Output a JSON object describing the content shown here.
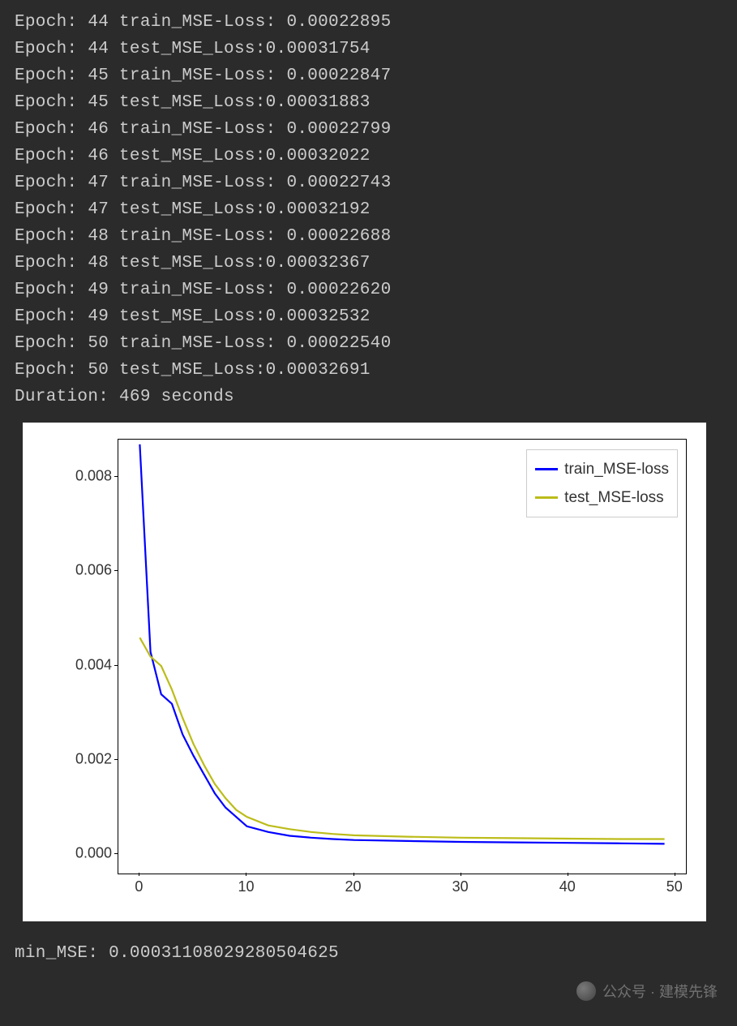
{
  "log": {
    "lines": [
      "Epoch: 44 train_MSE-Loss: 0.00022895",
      "Epoch: 44 test_MSE_Loss:0.00031754",
      "Epoch: 45 train_MSE-Loss: 0.00022847",
      "Epoch: 45 test_MSE_Loss:0.00031883",
      "Epoch: 46 train_MSE-Loss: 0.00022799",
      "Epoch: 46 test_MSE_Loss:0.00032022",
      "Epoch: 47 train_MSE-Loss: 0.00022743",
      "Epoch: 47 test_MSE_Loss:0.00032192",
      "Epoch: 48 train_MSE-Loss: 0.00022688",
      "Epoch: 48 test_MSE_Loss:0.00032367",
      "Epoch: 49 train_MSE-Loss: 0.00022620",
      "Epoch: 49 test_MSE_Loss:0.00032532",
      "Epoch: 50 train_MSE-Loss: 0.00022540",
      "Epoch: 50 test_MSE_Loss:0.00032691"
    ],
    "blank": "",
    "duration": "Duration: 469 seconds"
  },
  "legend": {
    "train": "train_MSE-loss",
    "test": "test_MSE-loss"
  },
  "yticks": [
    "0.000",
    "0.002",
    "0.004",
    "0.006",
    "0.008"
  ],
  "xticks": [
    "0",
    "10",
    "20",
    "30",
    "40",
    "50"
  ],
  "footer": "min_MSE: 0.00031108029280504625",
  "watermark": "公众号 · 建模先锋",
  "chart_data": {
    "type": "line",
    "title": "",
    "xlabel": "",
    "ylabel": "",
    "xlim": [
      -2,
      51
    ],
    "ylim": [
      -0.0004,
      0.0088
    ],
    "x": [
      0,
      1,
      2,
      3,
      4,
      5,
      6,
      7,
      8,
      9,
      10,
      12,
      14,
      16,
      18,
      20,
      25,
      30,
      35,
      40,
      45,
      49
    ],
    "series": [
      {
        "name": "train_MSE-loss",
        "color": "#0000ff",
        "values": [
          0.0087,
          0.0043,
          0.0034,
          0.0032,
          0.00255,
          0.0021,
          0.0017,
          0.0013,
          0.001,
          0.0008,
          0.0006,
          0.00048,
          0.0004,
          0.00036,
          0.00033,
          0.00031,
          0.00029,
          0.00027,
          0.00026,
          0.00025,
          0.00024,
          0.00023
        ]
      },
      {
        "name": "test_MSE-loss",
        "color": "#bcbc1a",
        "values": [
          0.0046,
          0.0042,
          0.004,
          0.0035,
          0.0029,
          0.00235,
          0.0019,
          0.0015,
          0.0012,
          0.00095,
          0.0008,
          0.00062,
          0.00054,
          0.00048,
          0.00044,
          0.00041,
          0.00038,
          0.00036,
          0.00035,
          0.00034,
          0.00033,
          0.00033
        ]
      }
    ],
    "legend_position": "upper right",
    "grid": false
  }
}
